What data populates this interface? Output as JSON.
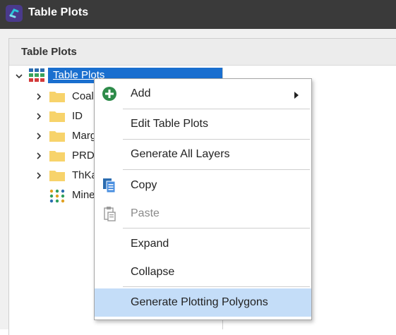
{
  "window": {
    "title": "Table Plots"
  },
  "panel": {
    "title": "Table Plots"
  },
  "tree": {
    "root": {
      "label": "Table Plots",
      "icon": "grid-table-icon"
    },
    "items": [
      {
        "label": "Coal",
        "icon": "folder-icon"
      },
      {
        "label": "ID",
        "icon": "folder-icon"
      },
      {
        "label": "Marg",
        "icon": "folder-icon"
      },
      {
        "label": "PRD",
        "icon": "folder-icon"
      },
      {
        "label": "ThKa",
        "icon": "folder-icon"
      },
      {
        "label": "Mine",
        "icon": "dots-plot-icon"
      }
    ]
  },
  "context_menu": {
    "items": [
      {
        "label": "Add",
        "icon": "add-circle-icon",
        "has_submenu": true
      },
      {
        "label": "Edit Table Plots"
      },
      {
        "label": "Generate All Layers"
      },
      {
        "label": "Copy",
        "icon": "copy-icon"
      },
      {
        "label": "Paste",
        "icon": "paste-icon",
        "disabled": true
      },
      {
        "label": "Expand"
      },
      {
        "label": "Collapse"
      },
      {
        "label": "Generate Plotting Polygons",
        "highlighted": true
      }
    ]
  },
  "colors": {
    "titlebar": "#3a3a3a",
    "selection": "#1a6fcf",
    "menu_highlight": "#c4ddf8",
    "folder": "#f7d36b",
    "add_green": "#2e8b4a"
  }
}
